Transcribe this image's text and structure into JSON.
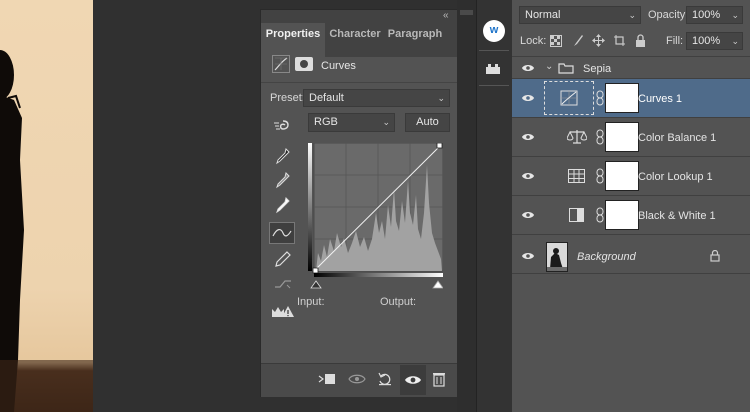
{
  "properties": {
    "tabs": [
      "Properties",
      "Character",
      "Paragraph"
    ],
    "adjustment_title": "Curves",
    "preset_label": "Preset:",
    "preset_value": "Default",
    "channel_value": "RGB",
    "auto_label": "Auto",
    "input_label": "Input:",
    "output_label": "Output:"
  },
  "layers_panel": {
    "blend_mode": "Normal",
    "opacity_label": "Opacity:",
    "opacity_value": "100%",
    "lock_label": "Lock:",
    "fill_label": "Fill:",
    "fill_value": "100%",
    "group_name": "Sepia",
    "layers": [
      {
        "name": "Curves 1",
        "icon": "curves-icon",
        "selected": true
      },
      {
        "name": "Color Balance 1",
        "icon": "balance-scale-icon",
        "selected": false
      },
      {
        "name": "Color Lookup 1",
        "icon": "grid-table-icon",
        "selected": false
      },
      {
        "name": "Black & White 1",
        "icon": "black-white-icon",
        "selected": false
      }
    ],
    "background_name": "Background"
  },
  "colors": {
    "selected_layer": "#4f6b8a",
    "panel_bg": "#535353",
    "app_bg": "#282828"
  }
}
